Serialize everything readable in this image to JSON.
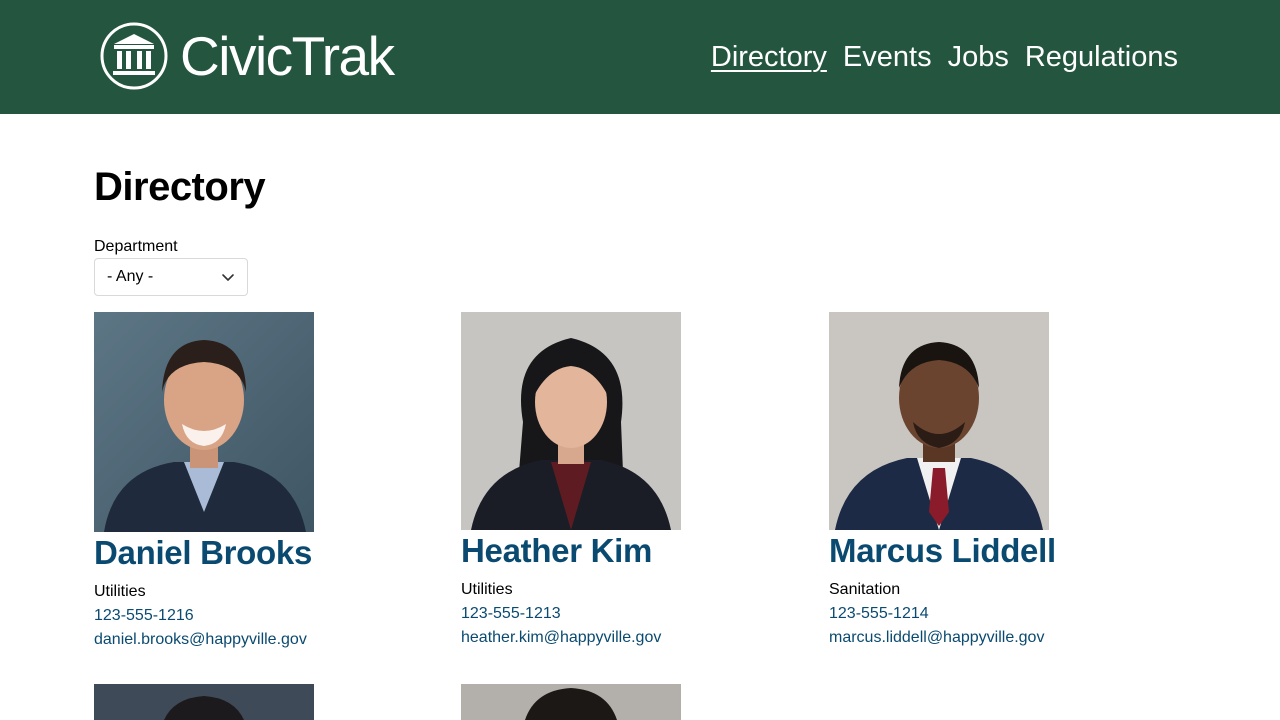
{
  "header": {
    "brand": "CivicTrak",
    "logo_icon": "government-building-icon",
    "nav": [
      {
        "label": "Directory",
        "active": true
      },
      {
        "label": "Events",
        "active": false
      },
      {
        "label": "Jobs",
        "active": false
      },
      {
        "label": "Regulations",
        "active": false
      }
    ]
  },
  "main": {
    "title": "Directory",
    "filter": {
      "label": "Department",
      "selected": "- Any -",
      "icon": "chevron-down-icon"
    },
    "people": [
      {
        "name": "Daniel Brooks",
        "department": "Utilities",
        "phone": "123-555-1216",
        "email": "daniel.brooks@happyville.gov"
      },
      {
        "name": "Heather Kim",
        "department": "Utilities",
        "phone": "123-555-1213",
        "email": "heather.kim@happyville.gov"
      },
      {
        "name": "Marcus Liddell",
        "department": "Sanitation",
        "phone": "123-555-1214",
        "email": "marcus.liddell@happyville.gov"
      }
    ]
  },
  "colors": {
    "header_bg": "#23553f",
    "link": "#0a4a70",
    "text": "#000000",
    "background": "#ffffff"
  }
}
